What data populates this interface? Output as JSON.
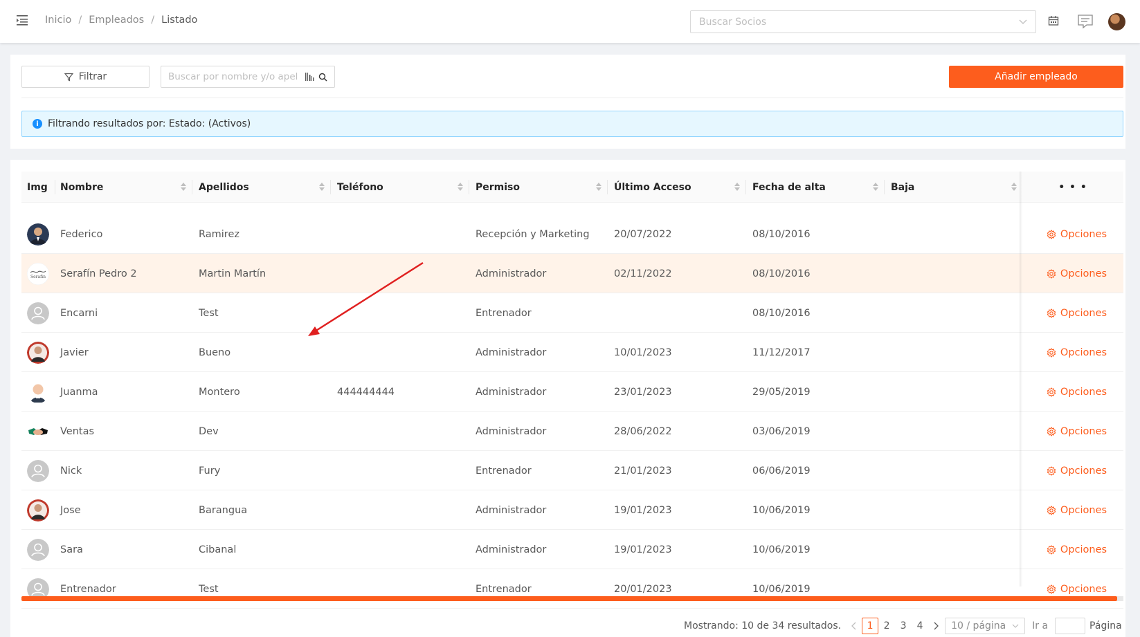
{
  "header": {
    "breadcrumb": [
      "Inicio",
      "Empleados",
      "Listado"
    ],
    "search_socios_placeholder": "Buscar Socios"
  },
  "toolbar": {
    "filter_label": "Filtrar",
    "search_placeholder": "Buscar por nombre y/o apel",
    "add_label": "Añadir empleado"
  },
  "alert": {
    "text": "Filtrando resultados por: Estado: (Activos)"
  },
  "table": {
    "columns": [
      "Img",
      "Nombre",
      "Apellidos",
      "Teléfono",
      "Permiso",
      "Último Acceso",
      "Fecha de alta",
      "Baja",
      "• • •"
    ],
    "options_label": "Opciones",
    "rows": [
      {
        "avatar": "photo-man-suit",
        "nombre": "Federico",
        "apellidos": "Ramirez",
        "telefono": "",
        "permiso": "Recepción y Marketing",
        "ultimo": "20/07/2022",
        "alta": "08/10/2016",
        "baja": "",
        "highlight": false
      },
      {
        "avatar": "logo-serafin",
        "nombre": "Serafín Pedro 2",
        "apellidos": "Martin Martín",
        "telefono": "",
        "permiso": "Administrador",
        "ultimo": "02/11/2022",
        "alta": "08/10/2016",
        "baja": "",
        "highlight": true
      },
      {
        "avatar": "default-user",
        "nombre": "Encarni",
        "apellidos": "Test",
        "telefono": "",
        "permiso": "Entrenador",
        "ultimo": "",
        "alta": "08/10/2016",
        "baja": "",
        "highlight": false
      },
      {
        "avatar": "photo-man-red",
        "nombre": "Javier",
        "apellidos": "Bueno",
        "telefono": "",
        "permiso": "Administrador",
        "ultimo": "10/01/2023",
        "alta": "11/12/2017",
        "baja": "",
        "highlight": false
      },
      {
        "avatar": "photo-baby",
        "nombre": "Juanma",
        "apellidos": "Montero",
        "telefono": "444444444",
        "permiso": "Administrador",
        "ultimo": "23/01/2023",
        "alta": "29/05/2019",
        "baja": "",
        "highlight": false
      },
      {
        "avatar": "photo-handshake",
        "nombre": "Ventas",
        "apellidos": "Dev",
        "telefono": "",
        "permiso": "Administrador",
        "ultimo": "28/06/2022",
        "alta": "03/06/2019",
        "baja": "",
        "highlight": false
      },
      {
        "avatar": "default-user",
        "nombre": "Nick",
        "apellidos": "Fury",
        "telefono": "",
        "permiso": "Entrenador",
        "ultimo": "21/01/2023",
        "alta": "06/06/2019",
        "baja": "",
        "highlight": false
      },
      {
        "avatar": "photo-man-red",
        "nombre": "Jose",
        "apellidos": "Barangua",
        "telefono": "",
        "permiso": "Administrador",
        "ultimo": "19/01/2023",
        "alta": "10/06/2019",
        "baja": "",
        "highlight": false
      },
      {
        "avatar": "default-user",
        "nombre": "Sara",
        "apellidos": "Cibanal",
        "telefono": "",
        "permiso": "Administrador",
        "ultimo": "19/01/2023",
        "alta": "10/06/2019",
        "baja": "",
        "highlight": false
      },
      {
        "avatar": "default-user",
        "nombre": "Entrenador",
        "apellidos": "Test",
        "telefono": "",
        "permiso": "Entrenador",
        "ultimo": "20/01/2023",
        "alta": "10/06/2019",
        "baja": "",
        "highlight": false
      }
    ]
  },
  "pagination": {
    "summary": "Mostrando: 10 de 34 resultados.",
    "pages": [
      "1",
      "2",
      "3",
      "4"
    ],
    "current": "1",
    "page_size": "10 / página",
    "goto_label": "Ir a",
    "page_label": "Página"
  },
  "colors": {
    "accent": "#fd5d1d",
    "highlight_row": "#fff3e9",
    "alert_bg": "#e6f7ff",
    "annotation_arrow": "#e02020"
  }
}
